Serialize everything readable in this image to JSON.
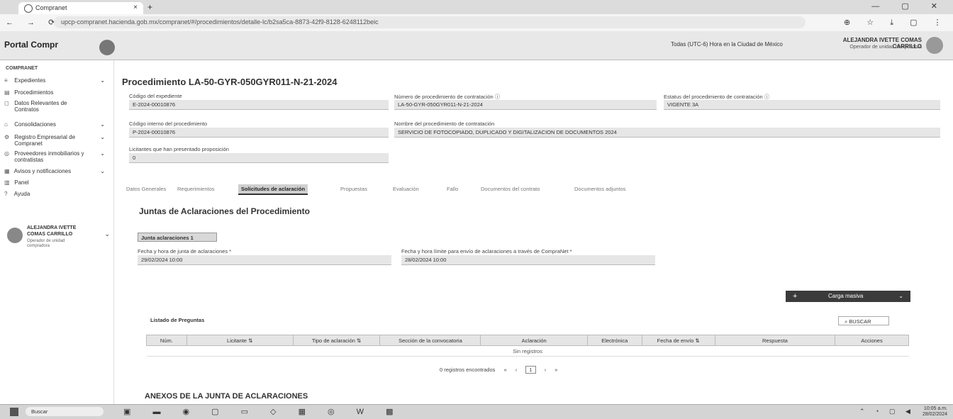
{
  "browser": {
    "tab_title": "Compranet",
    "tab_close": "×",
    "new_tab": "+",
    "window_controls": "— ▢ ✕",
    "nav": "← → ⟳",
    "url": "upcp-compranet.hacienda.gob.mx/compranet/#/procedimientos/detalle-lc/b2sa5ca-8873-42f9-8128-6248112beic",
    "tools": "⊕ ☆ ⤓ ▢ ⋮"
  },
  "header": {
    "logo": "Portal Compr",
    "timezone": "Todas (UTC-6) Hora en la Ciudad de México",
    "user_name": "ALEJANDRA IVETTE COMAS CARRILLO",
    "user_role": "Operador de unidad compradora"
  },
  "sidebar": {
    "section": "COMPRANET",
    "items": [
      {
        "icon": "≡",
        "label": "Expedientes",
        "chev": "⌄"
      },
      {
        "icon": "▤",
        "label": "Procedimientos",
        "chev": ""
      },
      {
        "icon": "◻",
        "label": "Datos Relevantes de Contratos",
        "chev": ""
      },
      {
        "icon": "⌂",
        "label": "Consolidaciones",
        "chev": "⌄"
      },
      {
        "icon": "⚙",
        "label": "Registro Empresarial de Compranet",
        "chev": "⌄"
      },
      {
        "icon": "◎",
        "label": "Proveedores inmobiliarios y contratistas",
        "chev": "⌄"
      },
      {
        "icon": "▦",
        "label": "Avisos y notificaciones",
        "chev": "⌄"
      },
      {
        "icon": "▥",
        "label": "Panel",
        "chev": ""
      },
      {
        "icon": "?",
        "label": "Ayuda",
        "chev": ""
      }
    ],
    "user_name": "ALEJANDRA IVETTE COMAS CARRILLO",
    "user_role": "Operador de unidad compradora",
    "user_chev": "⌄"
  },
  "main": {
    "title": "Procedimiento LA-50-GYR-050GYR011-N-21-2024",
    "fields": {
      "expediente_label": "Código del expediente",
      "expediente_value": "E-2024-00010876",
      "numero_label": "Número de procedimiento de contratación ⓘ",
      "numero_value": "LA-50-GYR-050GYR011-N-21-2024",
      "estatus_label": "Estatus del procedimiento de contratación ⓘ",
      "estatus_value": "VIGENTE 3A",
      "codigo_label": "Código interno del procedimiento",
      "codigo_value": "P-2024-00010876",
      "nombre_label": "Nombre del procedimiento de contratación",
      "nombre_value": "SERVICIO DE FOTOCOPIADO, DUPLICADO Y DIGITALIZACION DE DOCUMENTOS 2024",
      "licitantes_label": "Licitantes que han presentado proposición",
      "licitantes_value": "0"
    },
    "tabs": [
      {
        "label": "Datos Generales",
        "active": false
      },
      {
        "label": "Requerimientos",
        "active": false
      },
      {
        "label": "Solicitudes de aclaración",
        "active": true
      },
      {
        "label": "Propuestas",
        "active": false
      },
      {
        "label": "Evaluación",
        "active": false
      },
      {
        "label": "Fallo",
        "active": false
      },
      {
        "label": "Documentos del contrato",
        "active": false
      },
      {
        "label": "Documentos adjuntos",
        "active": false
      }
    ],
    "section_title": "Juntas de Aclaraciones del Procedimiento",
    "subtab": "Junta aclaraciones 1",
    "fecha_junta_label": "Fecha y hora de junta de aclaraciones *",
    "fecha_junta_value": "29/02/2024 10:00",
    "fecha_limite_label": "Fecha y hora límite para envío de aclaraciones a través de CompraNet *",
    "fecha_limite_value": "28/02/2024 10:00",
    "mass_button": "Carga masiva",
    "mass_plus": "+",
    "mass_chev": "⌄",
    "questions_title": "Listado de Preguntas",
    "search_button": "⌕ BUSCAR",
    "table_headers": [
      "Núm.",
      "Licitante ⇅",
      "Tipo de aclaración ⇅",
      "Sección de la convocatoria",
      "Aclaración",
      "Electrónica",
      "Fecha de envío ⇅",
      "Respuesta",
      "Acciones"
    ],
    "empty_text": "Sin registros",
    "pager_text": "0 registros encontrados",
    "pager_prev": "‹",
    "pager_first": "«",
    "pager_page": "1",
    "pager_next": "›",
    "pager_last": "»",
    "annex_title": "ANEXOS DE LA JUNTA DE ACLARACIONES"
  },
  "taskbar": {
    "search": "Buscar",
    "apps": "▣ ▬ ◉ ▢ ▭ ◇ ▦ ◎ W ▩",
    "tray": "⌃ ◔ ▢ ◀",
    "time": "10:05 a.m.",
    "date": "28/02/2024"
  }
}
